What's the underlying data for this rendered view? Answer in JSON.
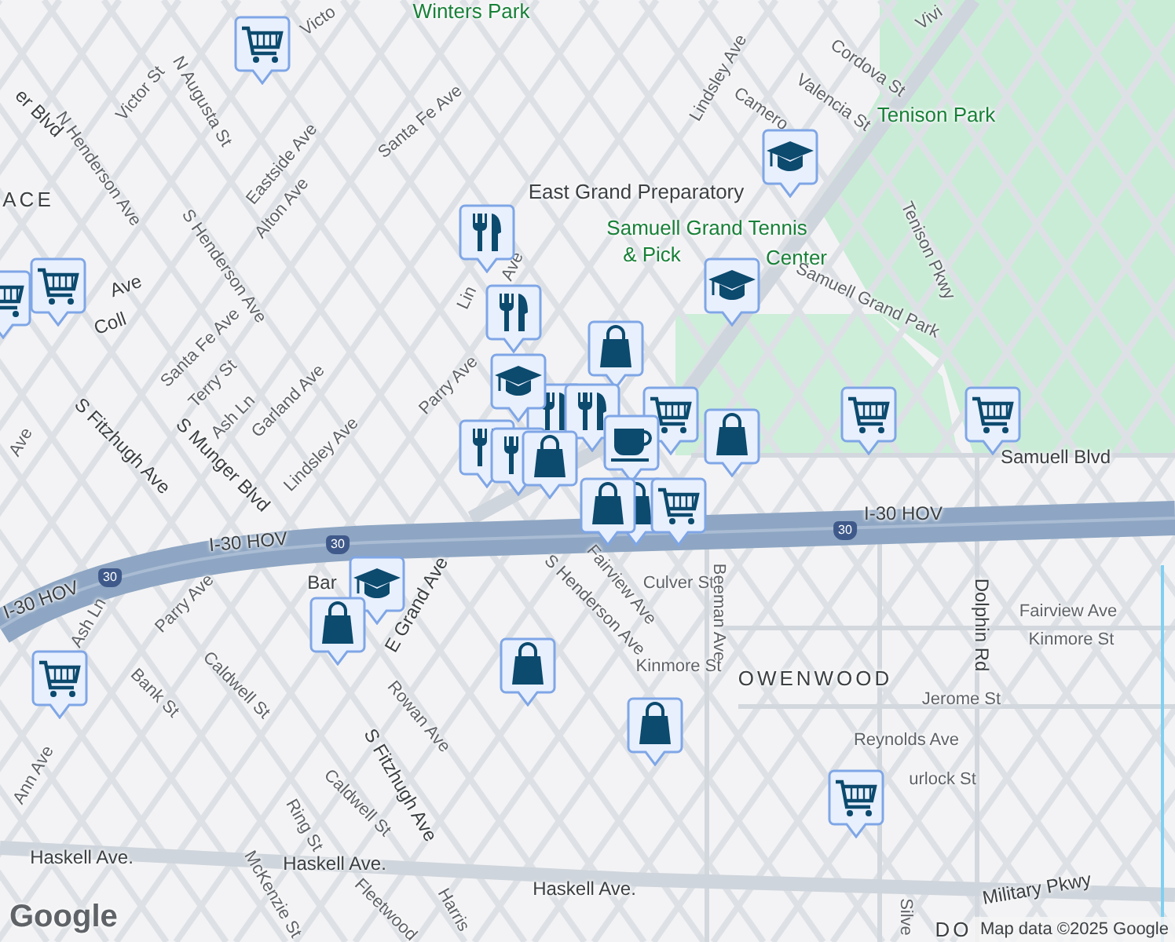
{
  "map": {
    "labels": [
      {
        "text": "Winters Park",
        "kind": "park"
      },
      {
        "text": "Victo",
        "kind": "street"
      },
      {
        "text": "Vivi",
        "kind": "street"
      },
      {
        "text": "Lindsley Ave",
        "kind": "street"
      },
      {
        "text": "Cordova St",
        "kind": "street"
      },
      {
        "text": "Valencia St",
        "kind": "street"
      },
      {
        "text": "Camero",
        "kind": "street"
      },
      {
        "text": "Tenison Park",
        "kind": "park"
      },
      {
        "text": "East Grand Preparatory",
        "kind": "poi"
      },
      {
        "text": "Samuell Grand Tennis",
        "kind": "park"
      },
      {
        "text": "& Pick",
        "kind": "park"
      },
      {
        "text": "Center",
        "kind": "park"
      },
      {
        "text": "Tenison Pkwy",
        "kind": "street"
      },
      {
        "text": "Samuell Grand Park",
        "kind": "street"
      },
      {
        "text": "Santa Fe Ave",
        "kind": "street"
      },
      {
        "text": "Eastside Ave",
        "kind": "street"
      },
      {
        "text": "Alton Ave",
        "kind": "street"
      },
      {
        "text": "N Augusta St",
        "kind": "street"
      },
      {
        "text": "N Henderson Ave",
        "kind": "street"
      },
      {
        "text": "Victor St",
        "kind": "street"
      },
      {
        "text": "er Blvd",
        "kind": "major"
      },
      {
        "text": "ACE",
        "kind": "area"
      },
      {
        "text": "S Henderson Ave",
        "kind": "street"
      },
      {
        "text": "Santa Fe Ave",
        "kind": "street"
      },
      {
        "text": "Terry St",
        "kind": "street"
      },
      {
        "text": "Ash Ln",
        "kind": "street"
      },
      {
        "text": "Garland Ave",
        "kind": "street"
      },
      {
        "text": "Lindsley Ave",
        "kind": "street"
      },
      {
        "text": "Parry Ave",
        "kind": "street"
      },
      {
        "text": "Lin",
        "kind": "street"
      },
      {
        "text": "Ave",
        "kind": "street"
      },
      {
        "text": "S Munger Blvd",
        "kind": "major"
      },
      {
        "text": "S Fitzhugh Ave",
        "kind": "major"
      },
      {
        "text": "Coll",
        "kind": "major"
      },
      {
        "text": "Ave",
        "kind": "major"
      },
      {
        "text": "Ave",
        "kind": "street"
      },
      {
        "text": "I-30 HOV",
        "kind": "major"
      },
      {
        "text": "I-30 HOV",
        "kind": "major"
      },
      {
        "text": "I-30 HOV",
        "kind": "major"
      },
      {
        "text": "30",
        "kind": "shield"
      },
      {
        "text": "30",
        "kind": "shield"
      },
      {
        "text": "30",
        "kind": "shield"
      },
      {
        "text": "Samuell Blvd",
        "kind": "major"
      },
      {
        "text": "Bar",
        "kind": "major"
      },
      {
        "text": "E Grand Ave",
        "kind": "major"
      },
      {
        "text": "S Henderson Ave",
        "kind": "street"
      },
      {
        "text": "Fairview Ave",
        "kind": "street"
      },
      {
        "text": "Culver St",
        "kind": "street"
      },
      {
        "text": "Beeman Ave",
        "kind": "street"
      },
      {
        "text": "Fairview Ave",
        "kind": "street"
      },
      {
        "text": "Kinmore St",
        "kind": "street"
      },
      {
        "text": "Kinmore St",
        "kind": "street"
      },
      {
        "text": "OWENWOOD",
        "kind": "area"
      },
      {
        "text": "Jerome St",
        "kind": "street"
      },
      {
        "text": "Reynolds Ave",
        "kind": "street"
      },
      {
        "text": "urlock St",
        "kind": "street"
      },
      {
        "text": "Dolphin Rd",
        "kind": "major"
      },
      {
        "text": "Parry Ave",
        "kind": "street"
      },
      {
        "text": "Caldwell St",
        "kind": "street"
      },
      {
        "text": "Bank St",
        "kind": "street"
      },
      {
        "text": "Ash Ln",
        "kind": "street"
      },
      {
        "text": "Ann Ave",
        "kind": "street"
      },
      {
        "text": "Rowan Ave",
        "kind": "street"
      },
      {
        "text": "S Fitzhugh Ave",
        "kind": "major"
      },
      {
        "text": "Caldwell St",
        "kind": "street"
      },
      {
        "text": "Ring St",
        "kind": "street"
      },
      {
        "text": "McKenzie St",
        "kind": "street"
      },
      {
        "text": "Fleetwood",
        "kind": "street"
      },
      {
        "text": "Harris",
        "kind": "street"
      },
      {
        "text": "Haskell Ave.",
        "kind": "major"
      },
      {
        "text": "Haskell Ave.",
        "kind": "major"
      },
      {
        "text": "Haskell Ave.",
        "kind": "major"
      },
      {
        "text": "Military Pkwy",
        "kind": "major"
      },
      {
        "text": "Silve",
        "kind": "street"
      },
      {
        "text": "DO",
        "kind": "area"
      }
    ],
    "markers": [
      {
        "kind": "cart"
      },
      {
        "kind": "cart"
      },
      {
        "kind": "cart"
      },
      {
        "kind": "cart"
      },
      {
        "kind": "cart"
      },
      {
        "kind": "cart"
      },
      {
        "kind": "cart"
      },
      {
        "kind": "cap"
      },
      {
        "kind": "cap"
      },
      {
        "kind": "fork"
      },
      {
        "kind": "bag"
      },
      {
        "kind": "fork"
      },
      {
        "kind": "fork"
      },
      {
        "kind": "fork"
      },
      {
        "kind": "cap"
      },
      {
        "kind": "cart"
      },
      {
        "kind": "fork"
      },
      {
        "kind": "fork"
      },
      {
        "kind": "bag"
      },
      {
        "kind": "cup"
      },
      {
        "kind": "bag"
      },
      {
        "kind": "bag"
      },
      {
        "kind": "bag"
      },
      {
        "kind": "cart"
      },
      {
        "kind": "cap"
      },
      {
        "kind": "bag"
      },
      {
        "kind": "bag"
      },
      {
        "kind": "bag"
      }
    ],
    "attribution": "Map data ©2025 Google",
    "logo": "Google"
  }
}
